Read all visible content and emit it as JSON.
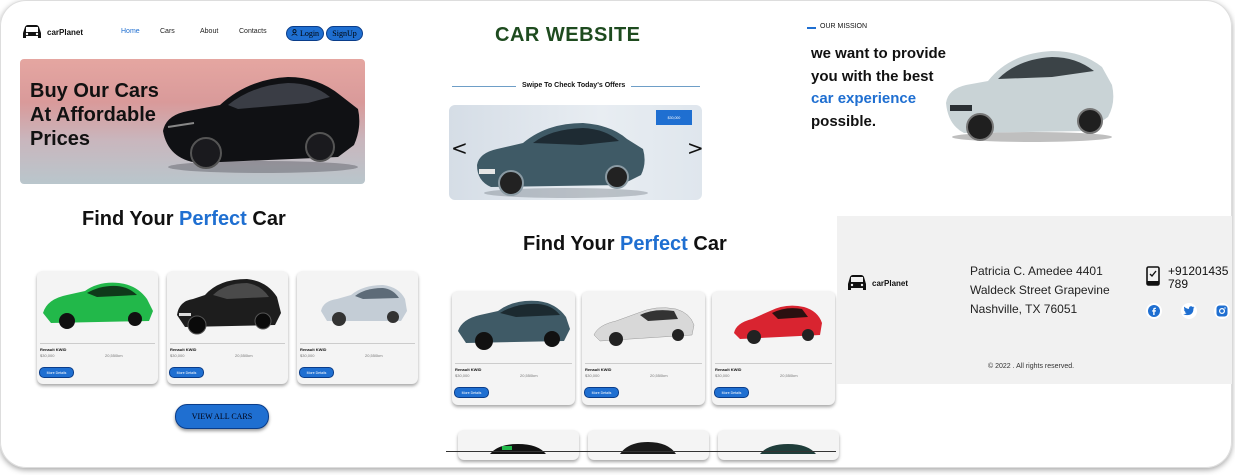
{
  "left": {
    "brand": "carPlanet",
    "nav": [
      "Home",
      "Cars",
      "About",
      "Contacts"
    ],
    "login": "Login",
    "signup": "SignUp",
    "hero_lines": [
      "Buy Our Cars",
      "At Affordable",
      "Prices"
    ],
    "heading_pre": "Find Your ",
    "heading_accent": "Perfect",
    "heading_post": " Car",
    "cards": [
      {
        "name": "Renault KWID",
        "price": "$30,000",
        "km": "20,550km",
        "button": "More Details",
        "color": "#22b84a"
      },
      {
        "name": "Renault KWID",
        "price": "$30,000",
        "km": "20,550km",
        "button": "More Details",
        "color": "#1d1d1d"
      },
      {
        "name": "Renault KWID",
        "price": "$30,000",
        "km": "20,550km",
        "button": "More Details",
        "color": "#c4cdd6"
      }
    ],
    "view_all": "VIEW ALL CARS"
  },
  "middle": {
    "title": "CAR WEBSITE",
    "swipe": "Swipe To Check Today's Offers",
    "offer_badge": "$30,000",
    "prev": "<",
    "next": ">",
    "heading_pre": "Find Your ",
    "heading_accent": "Perfect",
    "heading_post": " Car",
    "cards": [
      {
        "name": "Renault KWID",
        "price": "$30,000",
        "km": "20,550km",
        "button": "More Details",
        "color": "#3f5a66"
      },
      {
        "name": "Renault KWID",
        "price": "$30,000",
        "km": "20,550km",
        "button": "More Details",
        "color": "#d8d8d8"
      },
      {
        "name": "Renault KWID",
        "price": "$30,000",
        "km": "20,550km",
        "button": "More Details",
        "color": "#d92430"
      }
    ]
  },
  "right": {
    "mission_label": "OUR MISSION",
    "mission_lines": [
      "we want to provide",
      "you with the best",
      "car experience",
      "possible."
    ],
    "footer_brand": "carPlanet",
    "address_lines": [
      "Patricia C. Amedee 4401",
      "Waldeck Street Grapevine",
      "Nashville, TX 76051"
    ],
    "phone_lines": [
      "+91201435",
      "789"
    ],
    "copyright": "© 2022 . All rights reserved."
  },
  "colors": {
    "accent": "#1f6fd1",
    "title_green": "#1e4b1f",
    "footer_bg": "#f1f1f1"
  },
  "icons": [
    "car-logo-icon",
    "user-icon",
    "phone-icon",
    "facebook-icon",
    "twitter-icon",
    "instagram-icon"
  ]
}
